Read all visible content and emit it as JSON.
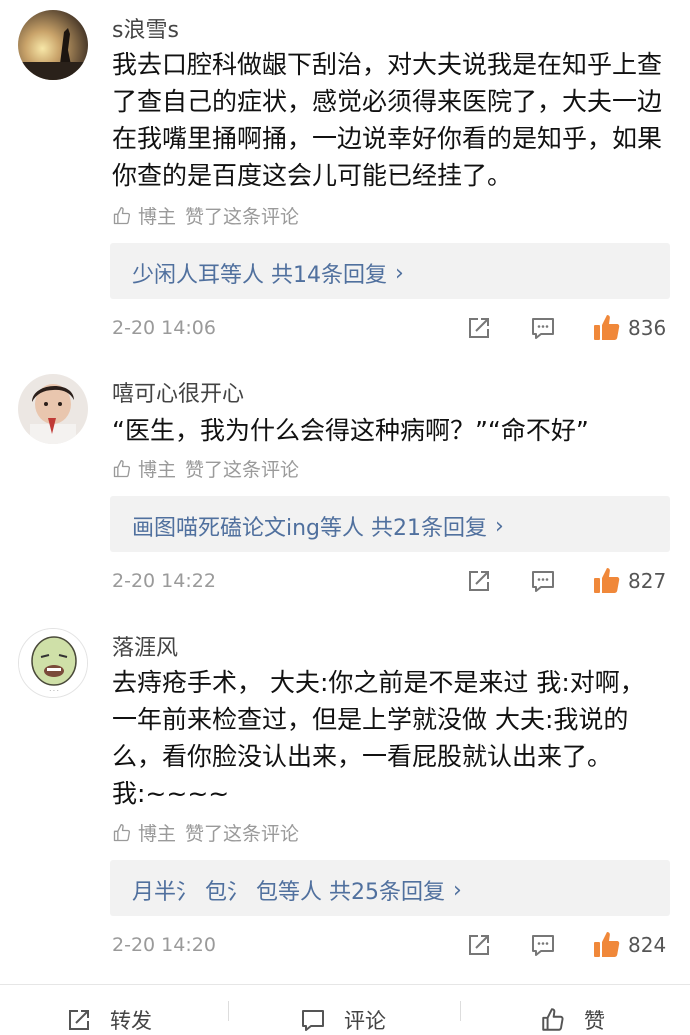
{
  "comments": [
    {
      "username": "s浪雪s",
      "lines": [
        "我去口腔科做龈下刮治，对大夫说我是在知乎上查",
        "了查自己的症状，感觉必须得来医院了，大夫一边",
        "在我嘴里捅啊捅，一边说幸好你看的是知乎，如果",
        "你查的是百度这会儿可能已经挂了。"
      ],
      "liked_author": "博主",
      "liked_text": "赞了这条评论",
      "reply_text": "少闲人耳等人  共14条回复",
      "time": "2-20 14:06",
      "likes": "836"
    },
    {
      "username": "嘻可心很开心",
      "lines": [
        "“医生，我为什么会得这种病啊？”“命不好”"
      ],
      "liked_author": "博主",
      "liked_text": "赞了这条评论",
      "reply_text": "画图喵死磕论文ing等人  共21条回复",
      "time": "2-20 14:22",
      "likes": "827"
    },
    {
      "username": "落涯风",
      "lines": [
        "去痔疮手术，  大夫:你之前是不是来过 我:对啊，",
        "一年前来检查过，但是上学就没做 大夫:我说的",
        "么，看你脸没认出来，一看屁股就认出来了。",
        "我:~~~~"
      ],
      "liked_author": "博主",
      "liked_text": "赞了这条评论",
      "reply_text": "月半氵 包氵 包等人  共25条回复",
      "time": "2-20 14:20",
      "likes": "824"
    }
  ],
  "bottom_bar": {
    "repost": "转发",
    "comment": "评论",
    "like": "赞"
  },
  "colors": {
    "link": "#50709e",
    "like_icon": "#f0883a",
    "reply_bg": "#f2f2f2"
  },
  "icons": [
    "thumb-up-outline-icon",
    "share-icon",
    "comment-icon",
    "thumb-up-filled-icon"
  ]
}
